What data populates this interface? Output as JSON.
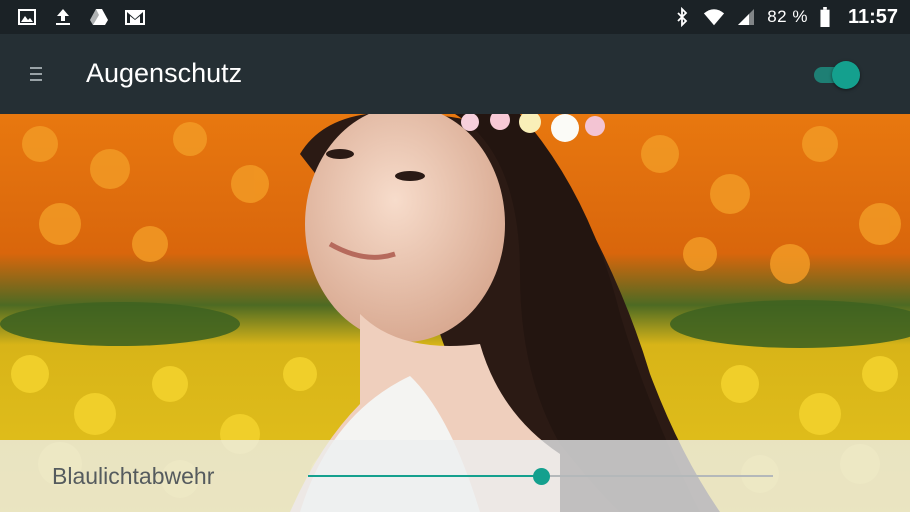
{
  "status_bar": {
    "left_icons": [
      "image-icon",
      "upload-icon",
      "drive-icon",
      "mail-icon"
    ],
    "right_icons": [
      "bluetooth-icon",
      "wifi-icon",
      "cell-signal-icon",
      "battery-icon"
    ],
    "battery_percent": "82 %",
    "time": "11:57"
  },
  "app_bar": {
    "title": "Augenschutz",
    "toggle_on": true,
    "accent_color": "#14a08e"
  },
  "panel": {
    "label": "Blaulichtabwehr",
    "slider_value_fraction": 0.5
  }
}
